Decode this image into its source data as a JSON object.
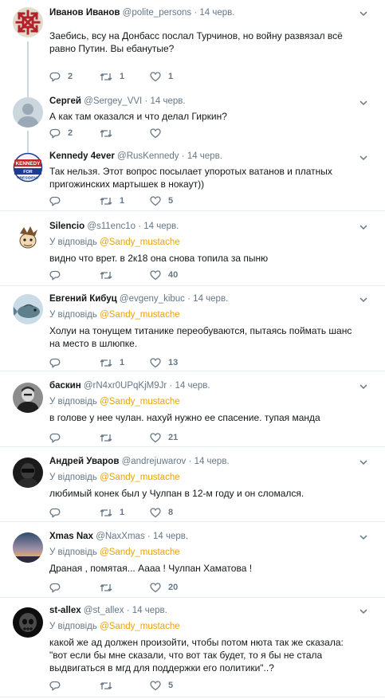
{
  "replying_prefix": "У відповідь",
  "tweets": [
    {
      "name": "Иванов Иванов",
      "handle": "@polite_persons",
      "dot": "·",
      "time": "14 черв.",
      "replying_to": "",
      "text": "Заебись, всу на Донбасс послал Турчинов, но войну развязал всё равно Путин. Вы ебанутые?",
      "replies": "2",
      "retweets": "1",
      "likes": "1",
      "avatar": "ornament-avatar"
    },
    {
      "name": "Сергей",
      "handle": "@Sergey_VVI",
      "dot": "·",
      "time": "14 черв.",
      "replying_to": "",
      "text": "А как там оказался и что делал Гиркин?",
      "replies": "2",
      "retweets": "",
      "likes": "",
      "avatar": "default-avatar"
    },
    {
      "name": "Kennedy 4ever",
      "handle": "@RusKennedy",
      "dot": "·",
      "time": "14 черв.",
      "replying_to": "",
      "text": "Так нельзя. Этот вопрос посылает упоротых ватанов и платных пригожинских мартышек в нокаут))",
      "replies": "",
      "retweets": "1",
      "likes": "5",
      "avatar": "kennedy-badge-avatar",
      "badge_top": "KENNEDY",
      "badge_mid": "FOR",
      "badge_bottom": "PRESIDENT"
    },
    {
      "name": "Silencio",
      "handle": "@s11enc1o",
      "dot": "·",
      "time": "14 черв.",
      "replying_to": "@Sandy_mustache",
      "text": "видно что врет. в 2к18 она снова топила за пыню",
      "replies": "",
      "retweets": "",
      "likes": "40",
      "avatar": "cartoon-avatar"
    },
    {
      "name": "Евгений Кибуц",
      "handle": "@evgeny_kibuc",
      "dot": "·",
      "time": "14 черв.",
      "replying_to": "@Sandy_mustache",
      "text": "Холуи на тонущем титанике переобуваются, пытаясь поймать шанс на место в шлюпке.",
      "replies": "",
      "retweets": "1",
      "likes": "13",
      "avatar": "fish-avatar"
    },
    {
      "name": "баскин",
      "handle": "@rN4xr0UPqKjM9Jr",
      "dot": "·",
      "time": "14 черв.",
      "replying_to": "@Sandy_mustache",
      "text": "в голове у нее чулан. нахуй нужно ее спасение. тупая манда",
      "replies": "",
      "retweets": "",
      "likes": "21",
      "avatar": "photo-avatar"
    },
    {
      "name": "Андрей Уваров",
      "handle": "@andrejuwarov",
      "dot": "·",
      "time": "14 черв.",
      "replying_to": "@Sandy_mustache",
      "text": "любимый конек был у Чулпан в 12-м году и он сломался.",
      "replies": "",
      "retweets": "1",
      "likes": "8",
      "avatar": "dark-avatar"
    },
    {
      "name": "Xmas Nax",
      "handle": "@NaxXmas",
      "dot": "·",
      "time": "14 черв.",
      "replying_to": "@Sandy_mustache",
      "text": "Драная , помятая... Аааа ! Чулпан Хаматова !",
      "replies": "",
      "retweets": "",
      "likes": "20",
      "avatar": "sunset-avatar"
    },
    {
      "name": "st-allex",
      "handle": "@st_allex",
      "dot": "·",
      "time": "14 черв.",
      "replying_to": "@Sandy_mustache",
      "text": "какой же ад должен произойти, чтобы потом нюта так же сказала: \"вот если бы мне сказали, что вот так будет, то я бы не стала выдвигаться в мгд для поддержки его политики\"..?",
      "replies": "",
      "retweets": "",
      "likes": "5",
      "avatar": "skull-avatar"
    }
  ],
  "colors": {
    "mention": "#e8a114",
    "muted": "#657786",
    "text": "#14171a",
    "divider": "#e6ecf0",
    "thread": "#ccd6dd"
  },
  "icons": {
    "reply": "reply-icon",
    "retweet": "retweet-icon",
    "like": "heart-icon",
    "menu": "chevron-down-icon"
  }
}
